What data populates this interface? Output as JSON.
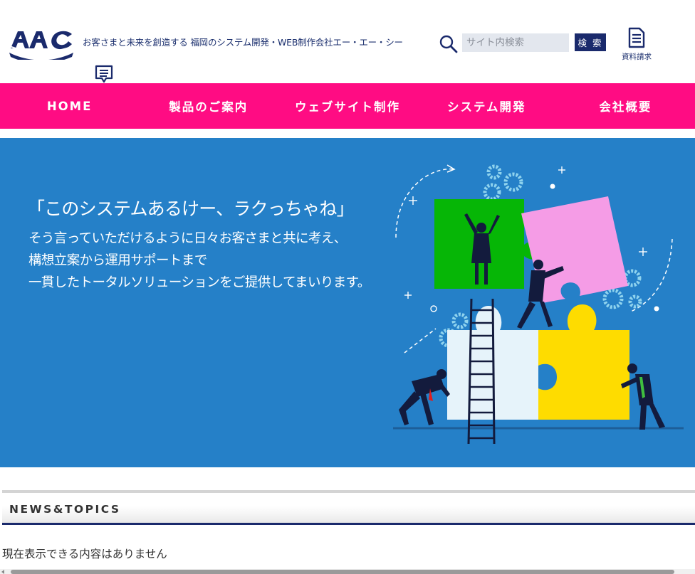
{
  "header": {
    "logo_name": "aac-logo",
    "tagline": "お客さまと未来を創造する 福岡のシステム開発・WEB制作会社エー・エー・シー",
    "search": {
      "placeholder": "サイト内検索",
      "button_label": "検 索"
    },
    "docs_label": "資料請求"
  },
  "nav": {
    "items": [
      {
        "label": "HOME"
      },
      {
        "label": "製品のご案内"
      },
      {
        "label": "ウェブサイト制作"
      },
      {
        "label": "システム開発"
      },
      {
        "label": "会社概要"
      }
    ]
  },
  "hero": {
    "headline": "「このシステムあるけー、ラクっちゃね」",
    "body": [
      "そう言っていただけるように日々お客さまと共に考え、",
      "構想立案から運用サポートまで",
      "一貫したトータルソリューションをご提供してまいります。"
    ]
  },
  "news": {
    "title": "NEWS&TOPICS",
    "empty_message": "現在表示できる内容はありません"
  },
  "colors": {
    "nav_bg": "#ff0c83",
    "hero_bg": "#2580c8",
    "brand_navy": "#1a2a6c",
    "puzzle_green": "#06b606",
    "puzzle_pink": "#f59ce6",
    "puzzle_yellow": "#fedc00",
    "puzzle_white": "#e6f3fa"
  }
}
